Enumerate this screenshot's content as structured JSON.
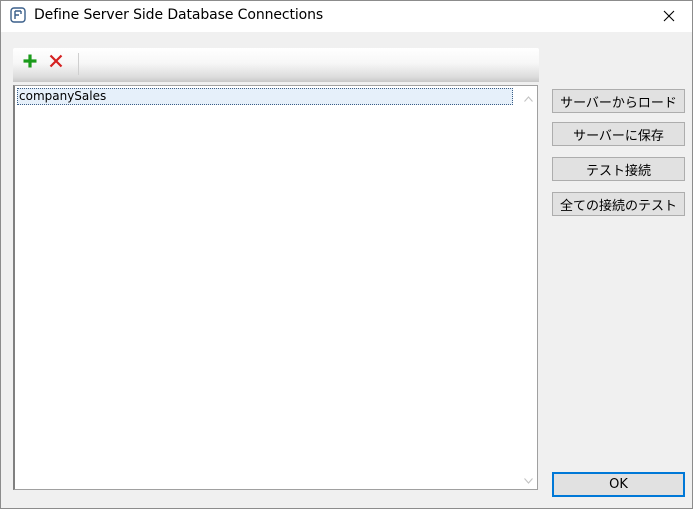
{
  "window": {
    "title": "Define Server Side Database Connections"
  },
  "toolbar": {
    "add_icon": "plus-icon",
    "delete_icon": "delete-x-icon",
    "add_color": "#1a9a1a",
    "delete_color": "#d42020"
  },
  "connections": {
    "items": [
      "companySales"
    ],
    "selected": "companySales"
  },
  "buttons": {
    "load_from_server": "サーバーからロード",
    "save_to_server": "サーバーに保存",
    "test_connection": "テスト接続",
    "test_all_connections": "全ての接続のテスト",
    "ok": "OK"
  }
}
